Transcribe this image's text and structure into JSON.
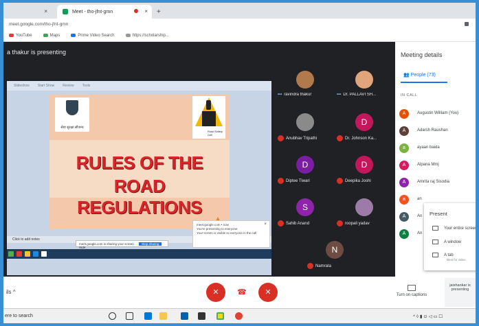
{
  "browser": {
    "tab_inactive_close": "×",
    "tab_title": "Meet - tho-jfnt-gmn",
    "tab_close": "×",
    "new_tab": "+",
    "url": "meet.google.com/tho-jfnt-gmn",
    "bookmarks": [
      {
        "label": "YouTube",
        "color": "#e53935"
      },
      {
        "label": "Maps",
        "color": "#34a853"
      },
      {
        "label": "Prime Video Search",
        "color": "#1a73e8"
      },
      {
        "label": "https://scholarship...",
        "color": "#999999"
      }
    ]
  },
  "stage": {
    "presenting_label": "a thakur is presenting",
    "ppt_menu": [
      "Slideshow",
      "Start Show",
      "Review",
      "Tools"
    ],
    "slide_title_line1": "RULES OF THE",
    "slide_title_line2": "ROAD REGULATIONS",
    "emblem_caption": "सेवा सुरक्षा सौजन्य",
    "signal_caption": "Road Safety Cell",
    "click_notes": "Click to add notes",
    "share_bar_text": "meet.google.com is sharing your screen",
    "stop_sharing": "Stop sharing",
    "hide": "Hide",
    "toast_title": "meet.google.com • now",
    "toast_text": "You're presenting to everyone",
    "toast_sub": "Your screen is visible to everyone in the call",
    "toast_close": "×"
  },
  "participants": [
    {
      "name": "ravindra thakur",
      "initial": "",
      "color": "#b07a4c",
      "muted": false
    },
    {
      "name": "Dr. PALLAVI SH...",
      "initial": "",
      "color": "#e0a57a",
      "muted": false
    },
    {
      "name": "Anubhav Tripathi",
      "initial": "",
      "color": "#8a8a8a",
      "muted": true
    },
    {
      "name": "Dr. Johnson Ka...",
      "initial": "D",
      "color": "#c2185b",
      "muted": true
    },
    {
      "name": "Diptee Tiwari",
      "initial": "D",
      "color": "#7b1fa2",
      "muted": true
    },
    {
      "name": "Deepika Joshi",
      "initial": "D",
      "color": "#c2185b",
      "muted": true
    },
    {
      "name": "Sahib Anand",
      "initial": "S",
      "color": "#8e24aa",
      "muted": true
    },
    {
      "name": "roopali yadav",
      "initial": "",
      "color": "#9c7ba8",
      "muted": true
    },
    {
      "name": "Namrata",
      "initial": "N",
      "color": "#6d4c41",
      "muted": true
    }
  ],
  "controls": {
    "details": "ils",
    "details_caret": "^",
    "mic_icon": "✕",
    "hangup_icon": "☎",
    "camera_icon": "✕",
    "captions_label": "Turn on captions",
    "present_label": "jaishankar is presenting"
  },
  "panel": {
    "title": "Meeting details",
    "people_tab": "People (73)",
    "in_call": "IN CALL",
    "people": [
      {
        "name": "Augustin William (You)",
        "initial": "A",
        "color": "#e65100"
      },
      {
        "name": "Adarsh Raushan",
        "initial": "A",
        "color": "#5d4037"
      },
      {
        "name": "ayaan baida",
        "initial": "a",
        "color": "#7cb342"
      },
      {
        "name": "Alpana Mmj",
        "initial": "A",
        "color": "#d81b60"
      },
      {
        "name": "Amrita raj Sisodia",
        "initial": "A",
        "color": "#8e24aa"
      },
      {
        "name": "an",
        "initial": "a",
        "color": "#f4511e"
      },
      {
        "name": "An",
        "initial": "A",
        "color": "#455a64"
      },
      {
        "name": "An",
        "initial": "A",
        "color": "#0b8043"
      }
    ]
  },
  "popover": {
    "heading": "Present",
    "options": [
      "Your entire screen",
      "A window",
      "A tab"
    ],
    "tab_sub": "Best for video"
  },
  "taskbar": {
    "search": "ere to search",
    "tray": "^ ◊ ▮ ⊙ ◁ ▭ ☐"
  }
}
